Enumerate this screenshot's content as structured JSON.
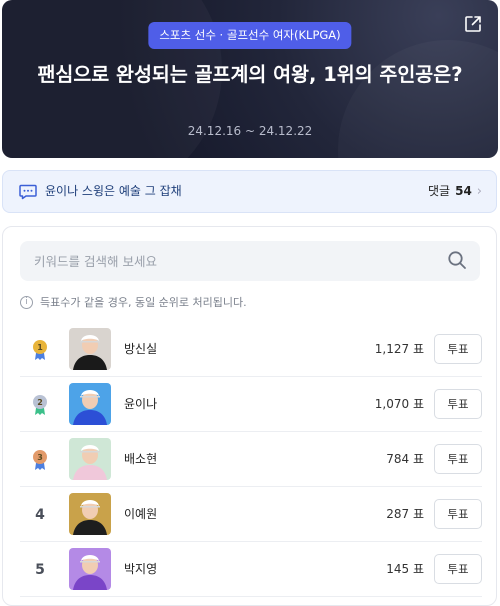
{
  "hero": {
    "category": "스포츠 선수 · 골프선수 여자(KLPGA)",
    "title": "팬심으로 완성되는 골프계의 여왕, 1위의 주인공은?",
    "period": "24.12.16 ~ 24.12.22",
    "share_icon": "share-icon"
  },
  "comment_bar": {
    "icon": "chat-bubble-icon",
    "topic": "윤이나 스윙은 예술 그 잡채",
    "count_label": "댓글",
    "count": "54"
  },
  "search": {
    "placeholder": "키워드를 검색해 보세요",
    "value": ""
  },
  "notice": "득표수가 같을 경우, 동일 순위로 처리됩니다.",
  "rankings": [
    {
      "rank": "1",
      "medal": "gold",
      "name": "방신실",
      "votes": "1,127 표",
      "button": "투표",
      "uniform": "#1a1a1a",
      "bg": "#d9d4cf"
    },
    {
      "rank": "2",
      "medal": "silver",
      "name": "윤이나",
      "votes": "1,070 표",
      "button": "투표",
      "uniform": "#2c4fd6",
      "bg": "#4da3e8"
    },
    {
      "rank": "3",
      "medal": "bronze",
      "name": "배소현",
      "votes": "784 표",
      "button": "투표",
      "uniform": "#f0c8da",
      "bg": "#cfe7d6"
    },
    {
      "rank": "4",
      "medal": "",
      "name": "이예원",
      "votes": "287 표",
      "button": "투표",
      "uniform": "#1e1e1e",
      "bg": "#c9a24a"
    },
    {
      "rank": "5",
      "medal": "",
      "name": "박지영",
      "votes": "145 표",
      "button": "투표",
      "uniform": "#7a45c8",
      "bg": "#b48ae6"
    }
  ],
  "colors": {
    "accent": "#4f5ee8",
    "gold": "#e8b43a",
    "silver": "#b9c2d4",
    "bronze": "#e29a6a",
    "ribbon": "#4c7fe0",
    "ribbon_green": "#3cc08a"
  }
}
